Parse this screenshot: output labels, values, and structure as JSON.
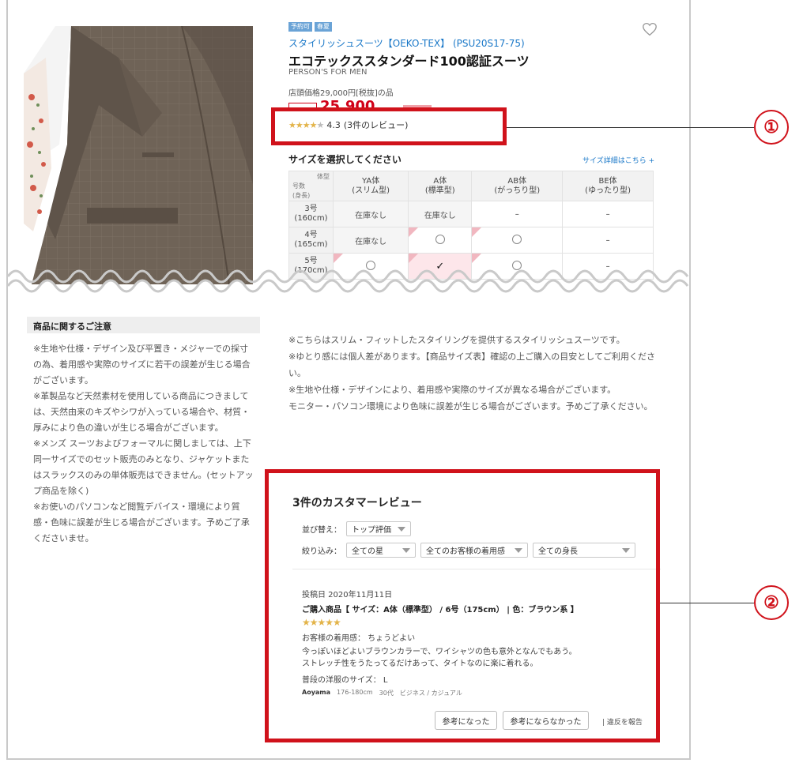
{
  "product": {
    "badges": [
      "予約可",
      "春夏"
    ],
    "series": "スタイリッシュスーツ【OEKO-TEX】 (PSU20S17-75)",
    "name": "エコテックススタンダード100認証スーツ",
    "brand": "PERSON'S FOR MEN",
    "store_price": "店頭価格29,000円[税抜]の品",
    "price": "25,900",
    "rating_value": "4.3",
    "rating_count": "(3件のレビュー)",
    "rating_stars": 4.3
  },
  "size_section": {
    "title": "サイズを選択してください",
    "detail_link": "サイズ詳細はこちら +",
    "corner_top": "体型",
    "corner_bottom": "号数\n(身長)",
    "columns": [
      {
        "l1": "YA体",
        "l2": "(スリム型)"
      },
      {
        "l1": "A体",
        "l2": "(標準型)"
      },
      {
        "l1": "AB体",
        "l2": "(がっちり型)"
      },
      {
        "l1": "BE体",
        "l2": "(ゆったり型)"
      }
    ],
    "rows": [
      {
        "l1": "3号",
        "l2": "(160cm)",
        "cells": [
          "在庫なし",
          "在庫なし",
          "–",
          "–"
        ]
      },
      {
        "l1": "4号",
        "l2": "(165cm)",
        "cells": [
          "在庫なし",
          "○",
          "○",
          "–"
        ]
      },
      {
        "l1": "5号",
        "l2": "(170cm)",
        "cells": [
          "○",
          "✓",
          "○",
          "–"
        ]
      }
    ]
  },
  "notice": {
    "heading": "商品に関するご注意",
    "lines": [
      "※生地や仕様・デザイン及び平置き・メジャーでの採寸の為、着用感や実際のサイズに若干の誤差が生じる場合がございます。",
      "※革製品など天然素材を使用している商品につきましては、天然由来のキズやシワが入っている場合や、材質・厚みにより色の違いが生じる場合がございます。",
      "※メンズ スーツおよびフォーマルに関しましては、上下同一サイズでのセット販売のみとなり、ジャケットまたはスラックスのみの単体販売はできません。(セットアップ商品を除く)",
      "※お使いのパソコンなど閲覧デバイス・環境により質感・色味に誤差が生じる場合がございます。予めご了承くださいませ。"
    ]
  },
  "description": [
    "※こちらはスリム・フィットしたスタイリングを提供するスタイリッシュスーツです。",
    "※ゆとり感には個人差があります。【商品サイズ表】確認の上ご購入の目安としてご利用ください。",
    "※生地や仕様・デザインにより、着用感や実際のサイズが異なる場合がございます。",
    "モニター・パソコン環境により色味に誤差が生じる場合がございます。予めご了承ください。"
  ],
  "reviews": {
    "title": "3件のカスタマーレビュー",
    "sort_label": "並び替え：",
    "sort_value": "トップ評価",
    "filter_label": "絞り込み：",
    "filter_star": "全ての星",
    "filter_fit": "全てのお客様の着用感",
    "filter_height": "全ての身長",
    "item": {
      "date": "投稿日 2020年11月11日",
      "purchase": "ご購入商品【 サイズ：A体（標準型） / 6号（175cm） | 色：ブラウン系 】",
      "stars": "★★★★★",
      "rating": 5,
      "fit": "お客様の着用感： ちょうどよい",
      "text_1": "今っぽいほどよいブラウンカラーで、ワイシャツの色も意外となんでもあう。",
      "text_2": "ストレッチ性をうたってるだけあって、タイトなのに楽に着れる。",
      "usual_size": "普段の洋服のサイズ： L",
      "user": "Aoyama",
      "height": "176-180cm",
      "age": "30代",
      "style": "ビジネス / カジュアル"
    },
    "helpful_button": "参考になった",
    "not_helpful_button": "参考にならなかった",
    "report": "| 違反を報告"
  },
  "callouts": [
    "①",
    "②"
  ],
  "colors": {
    "accent_red": "#d0121b",
    "link_blue": "#1a78c8",
    "star_gold": "#e3b44a",
    "selected_pink": "#fde6ea"
  }
}
